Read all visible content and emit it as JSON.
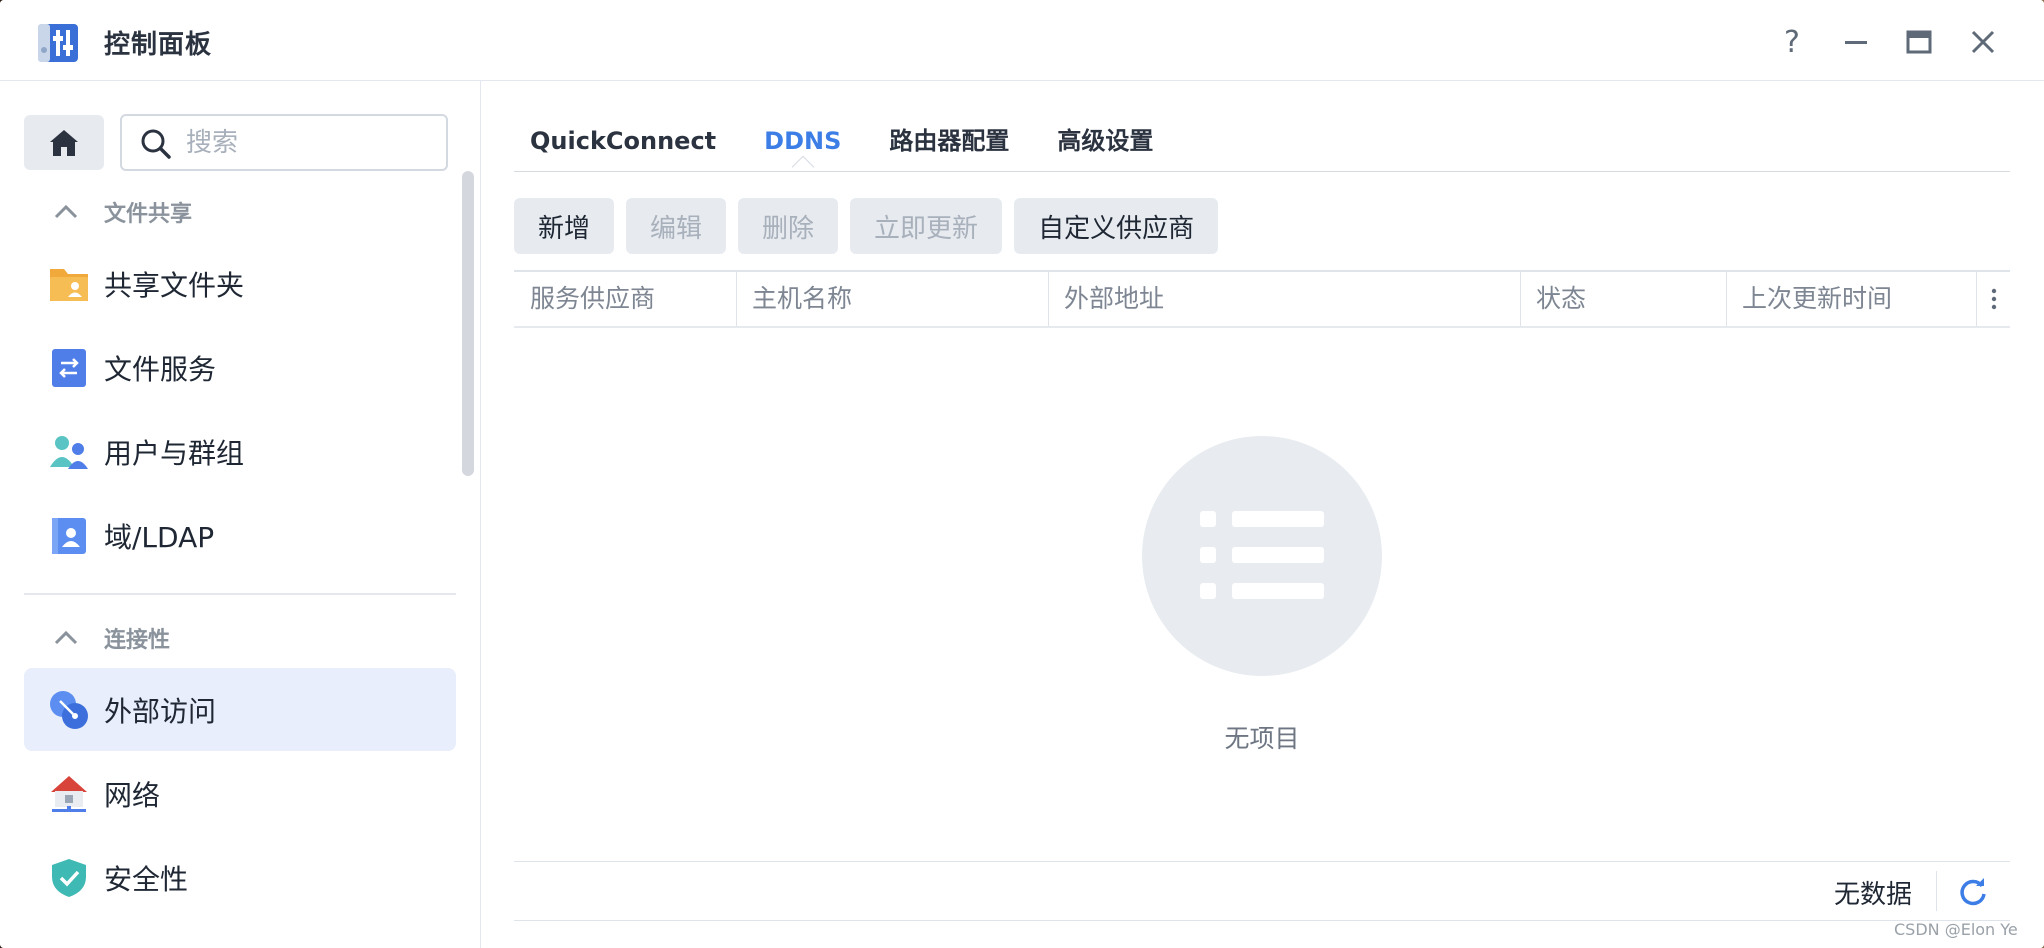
{
  "window": {
    "title": "控制面板",
    "help_label": "?"
  },
  "sidebar": {
    "search_placeholder": "搜索",
    "sections": [
      {
        "label": "文件共享",
        "items": [
          {
            "label": "共享文件夹",
            "icon": "shared-folder-icon"
          },
          {
            "label": "文件服务",
            "icon": "file-services-icon"
          },
          {
            "label": "用户与群组",
            "icon": "users-groups-icon"
          },
          {
            "label": "域/LDAP",
            "icon": "domain-ldap-icon"
          }
        ]
      },
      {
        "label": "连接性",
        "items": [
          {
            "label": "外部访问",
            "icon": "external-access-icon",
            "active": true
          },
          {
            "label": "网络",
            "icon": "network-icon"
          },
          {
            "label": "安全性",
            "icon": "security-icon"
          }
        ]
      }
    ]
  },
  "main": {
    "tabs": [
      {
        "label": "QuickConnect"
      },
      {
        "label": "DDNS",
        "active": true
      },
      {
        "label": "路由器配置"
      },
      {
        "label": "高级设置"
      }
    ],
    "toolbar": {
      "add": "新增",
      "edit": "编辑",
      "delete": "删除",
      "update_now": "立即更新",
      "custom_provider": "自定义供应商"
    },
    "columns": [
      "服务供应商",
      "主机名称",
      "外部地址",
      "状态",
      "上次更新时间"
    ],
    "empty_text": "无项目",
    "footer_status": "无数据"
  },
  "watermark": "CSDN @Elon Ye",
  "colors": {
    "accent": "#3d7ee6",
    "active_nav_bg": "#e8eefb",
    "button_bg": "#e7ebf0"
  }
}
